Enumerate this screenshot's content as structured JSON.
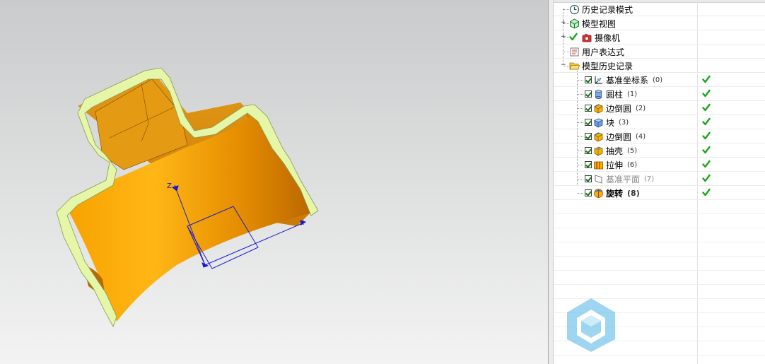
{
  "viewport": {
    "axis_labels": {
      "z": "Z",
      "x": "X"
    }
  },
  "navigator": {
    "items": [
      {
        "label": "历史记录模式",
        "num": "",
        "icon": "clock-icon",
        "style": "normal",
        "status": false
      },
      {
        "label": "模型视图",
        "num": "",
        "icon": "model-view-icon",
        "style": "normal",
        "status": false
      },
      {
        "label": "摄像机",
        "num": "",
        "icon": "camera-icon",
        "style": "normal",
        "status": false
      },
      {
        "label": "用户表达式",
        "num": "",
        "icon": "expression-icon",
        "style": "normal",
        "status": false
      },
      {
        "label": "模型历史记录",
        "num": "",
        "icon": "folder-open-icon",
        "style": "normal",
        "status": false
      },
      {
        "label": "基准坐标系",
        "num": "(0)",
        "icon": "datum-csys-icon",
        "style": "normal",
        "status": true
      },
      {
        "label": "圆柱",
        "num": "(1)",
        "icon": "cylinder-icon",
        "style": "normal",
        "status": true
      },
      {
        "label": "边倒圆",
        "num": "(2)",
        "icon": "edge-blend-icon",
        "style": "normal",
        "status": true
      },
      {
        "label": "块",
        "num": "(3)",
        "icon": "block-icon",
        "style": "normal",
        "status": true
      },
      {
        "label": "边倒圆",
        "num": "(4)",
        "icon": "edge-blend-icon",
        "style": "normal",
        "status": true
      },
      {
        "label": "抽壳",
        "num": "(5)",
        "icon": "shell-icon",
        "style": "normal",
        "status": true
      },
      {
        "label": "拉伸",
        "num": "(6)",
        "icon": "extrude-icon",
        "style": "normal",
        "status": true
      },
      {
        "label": "基准平面",
        "num": "(7)",
        "icon": "datum-plane-icon",
        "style": "disabled",
        "status": true
      },
      {
        "label": "旋转",
        "num": "(8)",
        "icon": "revolve-icon",
        "style": "bold",
        "status": true
      }
    ]
  },
  "colors": {
    "part_orange": "#f4a000",
    "shell_edge": "#e4f5a6",
    "check_green": "#1aa51a",
    "wcs_blue": "#1a1acc"
  }
}
